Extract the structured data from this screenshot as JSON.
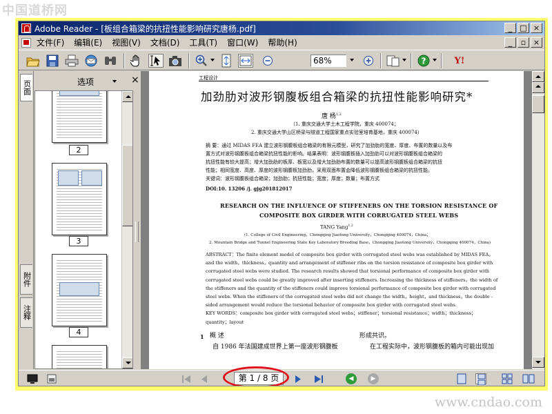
{
  "watermark_top": "中国道桥网",
  "watermark_bottom": "www.cndao.com",
  "window": {
    "title": "Adobe Reader - [板组合箱梁的抗扭性能影响研究唐杨.pdf]",
    "buttons": [
      "_",
      "□",
      "×"
    ],
    "mdi_buttons": [
      "_",
      "▫",
      "×"
    ]
  },
  "menu": [
    "文件(F)",
    "编辑(E)",
    "视图(V)",
    "文档(D)",
    "工具(T)",
    "窗口(W)",
    "帮助(H)"
  ],
  "toolbar": {
    "zoom_value": "68%",
    "icons": [
      "open-icon",
      "save-icon",
      "print-icon",
      "email-icon",
      "search-icon",
      "hand-tool-icon",
      "select-tool-icon",
      "snapshot-icon",
      "zoom-in-tool-icon",
      "fit-page-icon",
      "fit-width-icon",
      "zoom-out-icon",
      "zoom-in-icon",
      "page-layout-icon",
      "help-icon",
      "yahoo-icon"
    ],
    "yahoo_label": "Y!"
  },
  "left_panel": {
    "tabs": [
      "页面",
      "附件",
      "注释"
    ],
    "options_label": "选项",
    "close_label": "×",
    "thumbnails": [
      {
        "label": "2"
      },
      {
        "label": "3"
      },
      {
        "label": "4"
      }
    ]
  },
  "document": {
    "header": "工程设计",
    "title_cn": "加劲肋对波形钢腹板组合箱梁的抗扭性能影响研究*",
    "author_cn": "唐  杨",
    "author_cn_sup": "1,2",
    "affil_cn_1": "（1. 重庆交通大学土木工程学院，重庆  400074；",
    "affil_cn_2": "2. 重庆交通大学山区桥梁与隧道工程国家重点实验室培育基地，重庆  400074）",
    "abstract_cn": [
      "摘  要：通过 MIDAS FEA 建立波形钢腹板组合箱梁的有限元模型，研究了加劲肋的宽度、厚度、布置的数量以及布",
      "置方式对波形钢腹板组合箱梁抗扭性能的影响。结果表明：波形钢腹板插入加劲肋可以对波形钢腹板组合箱梁的",
      "抗扭性能有较大提高；增大加劲肋的板厚、板宽以及增大加劲肋布置的数量可以提高波形钢腹板组合箱梁的抗扭",
      "性能；相同宽度、高度、厚度的波形钢腹板加劲肋，采用双面布置会降低波形钢腹板组合箱梁的抗扭性能。"
    ],
    "keywords_cn": "关键词：波形钢腹板组合箱梁；加劲肋；抗扭性能；宽度；厚度；数量；布置方式",
    "doi": "DOI:10. 13206 /j. gjg201812017",
    "title_en_1": "RESEARCH ON THE INFLUENCE OF STIFFENERS ON THE TORSION RESISTANCE OF",
    "title_en_2": "COMPOSITE BOX GIRDER WITH CORRUGATED STEEL WEBS",
    "author_en": "TANG Yang",
    "author_en_sup": "1,2",
    "affil_en_1": "(1. College of Civil Engineering，Chongqing Jiaotong University，Chongqing 400074，China；",
    "affil_en_2": "2. Mountain Bridge and Tunnel Engineering State Key Laboratory Breeding Base，Chongqing Jiaotong University，Chongqing 400074，China)",
    "abstract_en": [
      "ABSTRACT：The finite element model of composite box girder with corrugated steel webs was established by MIDAS FEA，",
      "and the width，thickness，quantity and arrangement of stiffener ribs on the torsion resistance of composite box girder with",
      "corrugated steel webs were studied. The research results showed that torsional performance of composite box girder with",
      "corrugated steel webs could be greatly improved after inserting stiffeners. Increasing the thickness of stiffeners，the width of",
      "the stiffeners and the quantity of the stiffeners could improve torsional performance of composite box girder with corrugated",
      "steel webs. When the stiffeners of the corrugated steel webs did not change the width，height，and thickness，the double -",
      "sided arrangement would reduce the torsional behavior of composite box girder with corrugated steel webs."
    ],
    "keywords_en_1": "KEY WORDS：composite box girder with corrugated steel webs；stiffener；torsional resistance；width；thickness；",
    "keywords_en_2": "quantity；layout",
    "section_num": "1",
    "section_title": "概  述",
    "body_left": "自 1986 年法国建成世界上第一座波形钢腹板",
    "body_right_1": "形成共识。",
    "body_right_2": "在工程实际中，波形钢腹板的箱内可能出现加"
  },
  "status": {
    "page_indicator": "第 1 / 8 页"
  },
  "colors": {
    "frame": "#ffff6e",
    "titlebar_start": "#0a246a",
    "titlebar_end": "#a6caf0",
    "highlight_oval": "#e0101a",
    "chrome": "#d4d0c8"
  }
}
